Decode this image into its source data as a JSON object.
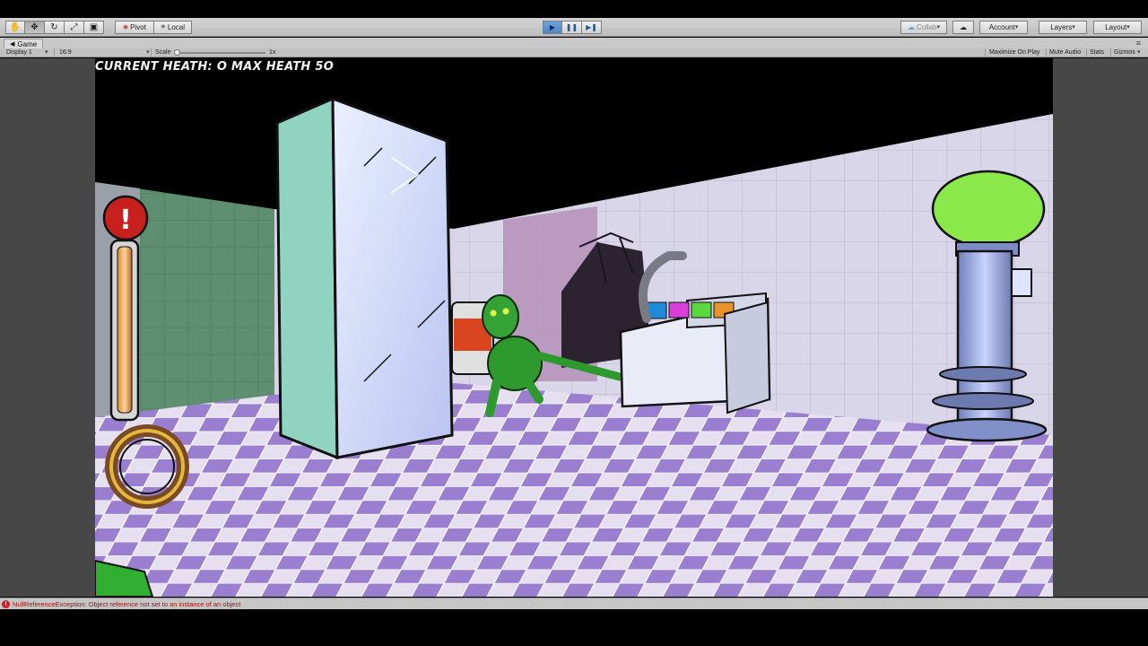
{
  "toolbar": {
    "tools": [
      {
        "name": "hand-tool",
        "glyph": "✋"
      },
      {
        "name": "move-tool",
        "glyph": "✥"
      },
      {
        "name": "rotate-tool",
        "glyph": "↻"
      },
      {
        "name": "scale-tool",
        "glyph": "⤢"
      },
      {
        "name": "rect-tool",
        "glyph": "▣"
      }
    ],
    "pivot_label": "Pivot",
    "local_label": "Local",
    "collab_label": "Collab",
    "account_label": "Account",
    "layers_label": "Layers",
    "layout_label": "Layout"
  },
  "game_tab": {
    "title": "Game",
    "display_label": "Display 1",
    "aspect_label": "16:9",
    "scale_label": "Scale",
    "scale_value": "1x",
    "maximize_label": "Maximize On Play",
    "mute_label": "Mute Audio",
    "stats_label": "Stats",
    "gizmos_label": "Gizmos"
  },
  "hud": {
    "health_text": "CURRENT HEATH: O MAX HEATH 5O",
    "warning_glyph": "!"
  },
  "console": {
    "error_message": "NullReferenceException: Object reference not set to an instance of an object"
  },
  "colors": {
    "play_blue": "#4d86c6",
    "error_red": "#d21d1d",
    "zombie_green": "#2e9a2e",
    "floor_purple": "#9a7fd0"
  }
}
